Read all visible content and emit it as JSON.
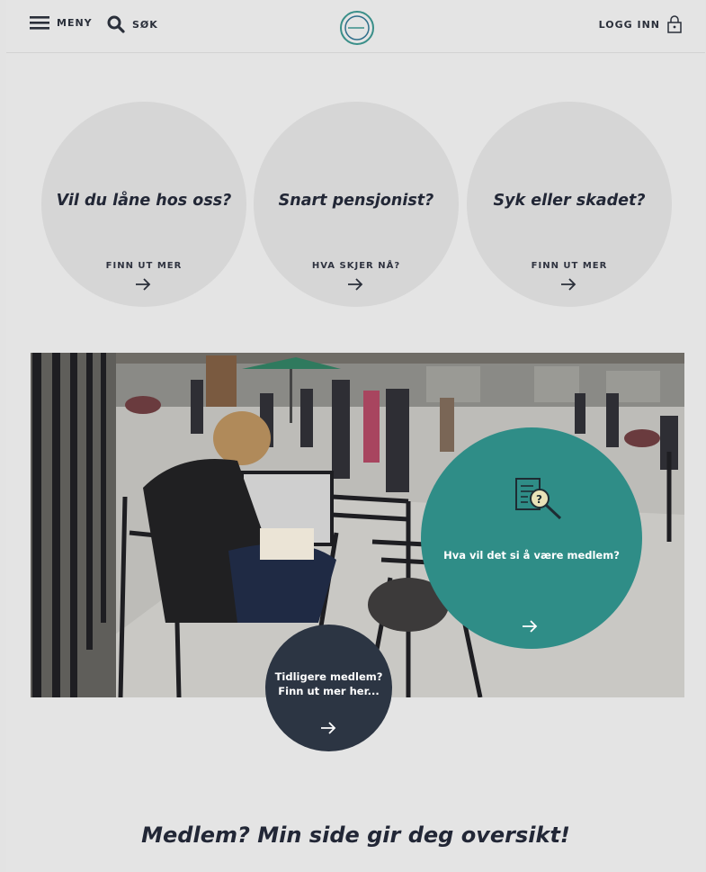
{
  "header": {
    "menu_label": "MENY",
    "search_label": "SØK",
    "login_label": "LOGG INN"
  },
  "circles": [
    {
      "question": "Vil du låne hos oss?",
      "cta": "FINN UT MER"
    },
    {
      "question": "Snart pensjonist?",
      "cta": "HVA SKJER NÅ?"
    },
    {
      "question": "Syk eller skadet?",
      "cta": "FINN UT MER"
    }
  ],
  "member_circle": {
    "text": "Hva vil det si å være medlem?"
  },
  "former_member": {
    "line1": "Tidligere medlem?",
    "line2": "Finn ut mer her..."
  },
  "bottom": {
    "heading": "Medlem? Min side gir deg oversikt!"
  },
  "colors": {
    "accent_teal": "#2f8d87",
    "dark_navy": "#2c3543",
    "background": "#e4e4e4",
    "circle_gray": "#d6d6d6"
  }
}
